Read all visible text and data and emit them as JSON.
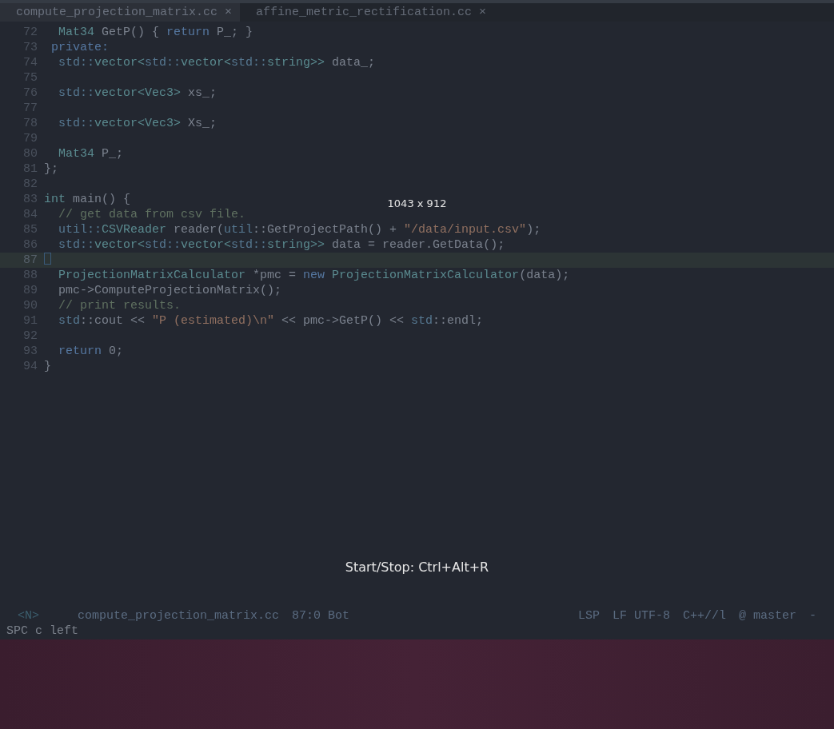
{
  "tabs": [
    {
      "label": "compute_projection_matrix.cc",
      "close": "×",
      "selected": true
    },
    {
      "label": "affine_metric_rectification.cc",
      "close": "×",
      "selected": false
    }
  ],
  "editor": {
    "lines": [
      {
        "number": "72",
        "current": false,
        "tokens": [
          {
            "text": "  Mat34",
            "kind": "type"
          },
          {
            "text": " GetP() { "
          },
          {
            "text": "return",
            "kind": "keyword"
          },
          {
            "text": " P_; }"
          }
        ]
      },
      {
        "number": "73",
        "current": false,
        "tokens": [
          {
            "text": " private:",
            "kind": "keyword"
          }
        ]
      },
      {
        "number": "74",
        "current": false,
        "tokens": [
          {
            "text": "  std::",
            "kind": "ns"
          },
          {
            "text": "vector<",
            "kind": "type"
          },
          {
            "text": "std::",
            "kind": "ns"
          },
          {
            "text": "vector<",
            "kind": "type"
          },
          {
            "text": "std::",
            "kind": "ns"
          },
          {
            "text": "string>>",
            "kind": "type"
          },
          {
            "text": " data_;"
          }
        ]
      },
      {
        "number": "75",
        "current": false
      },
      {
        "number": "76",
        "current": false,
        "tokens": [
          {
            "text": "  std::",
            "kind": "ns"
          },
          {
            "text": "vector<Vec3>",
            "kind": "type"
          },
          {
            "text": " xs_;"
          }
        ]
      },
      {
        "number": "77",
        "current": false
      },
      {
        "number": "78",
        "current": false,
        "tokens": [
          {
            "text": "  std::",
            "kind": "ns"
          },
          {
            "text": "vector<Vec3>",
            "kind": "type"
          },
          {
            "text": " Xs_;"
          }
        ]
      },
      {
        "number": "79",
        "current": false
      },
      {
        "number": "80",
        "current": false,
        "tokens": [
          {
            "text": "  Mat34",
            "kind": "type"
          },
          {
            "text": " P_;"
          }
        ]
      },
      {
        "number": "81",
        "current": false,
        "tokens": [
          {
            "text": "};"
          }
        ]
      },
      {
        "number": "82",
        "current": false
      },
      {
        "number": "83",
        "current": false,
        "tokens": [
          {
            "text": "int",
            "kind": "type"
          },
          {
            "text": " main() {"
          }
        ]
      },
      {
        "number": "84",
        "current": false,
        "tokens": [
          {
            "text": "  // get data from csv file.",
            "kind": "comment"
          }
        ]
      },
      {
        "number": "85",
        "current": false,
        "tokens": [
          {
            "text": "  util::",
            "kind": "ns"
          },
          {
            "text": "CSVReader",
            "kind": "type"
          },
          {
            "text": " reader("
          },
          {
            "text": "util",
            "kind": "ns"
          },
          {
            "text": "::GetProjectPath() + "
          },
          {
            "text": "\"/data/input.csv\"",
            "kind": "string"
          },
          {
            "text": ");"
          }
        ]
      },
      {
        "number": "86",
        "current": false,
        "tokens": [
          {
            "text": "  std::",
            "kind": "ns"
          },
          {
            "text": "vector<",
            "kind": "type"
          },
          {
            "text": "std::",
            "kind": "ns"
          },
          {
            "text": "vector<",
            "kind": "type"
          },
          {
            "text": "std::",
            "kind": "ns"
          },
          {
            "text": "string>>",
            "kind": "type"
          },
          {
            "text": " data = reader.GetData();"
          }
        ]
      },
      {
        "number": "87",
        "current": true
      },
      {
        "number": "88",
        "current": false,
        "tokens": [
          {
            "text": "  ProjectionMatrixCalculator",
            "kind": "type"
          },
          {
            "text": " *pmc = "
          },
          {
            "text": "new",
            "kind": "keyword"
          },
          {
            "text": " ProjectionMatrixCalculator",
            "kind": "type"
          },
          {
            "text": "(data);"
          }
        ]
      },
      {
        "number": "89",
        "current": false,
        "tokens": [
          {
            "text": "  pmc->ComputeProjectionMatrix();"
          }
        ]
      },
      {
        "number": "90",
        "current": false,
        "tokens": [
          {
            "text": "  // print results.",
            "kind": "comment"
          }
        ]
      },
      {
        "number": "91",
        "current": false,
        "tokens": [
          {
            "text": "  std",
            "kind": "ns"
          },
          {
            "text": "::cout << "
          },
          {
            "text": "\"P (estimated)\\n\"",
            "kind": "string"
          },
          {
            "text": " << pmc->GetP() << "
          },
          {
            "text": "std",
            "kind": "ns"
          },
          {
            "text": "::endl;"
          }
        ]
      },
      {
        "number": "92",
        "current": false
      },
      {
        "number": "93",
        "current": false,
        "tokens": [
          {
            "text": "  return",
            "kind": "keyword"
          },
          {
            "text": " 0;"
          }
        ]
      },
      {
        "number": "94",
        "current": false,
        "tokens": [
          {
            "text": "}"
          }
        ]
      }
    ]
  },
  "overlays": [
    "1043 x 912",
    "Start/Stop: Ctrl+Alt+R"
  ],
  "status_bar": {
    "mode": "<N>",
    "file": "compute_projection_matrix.cc",
    "position": "87:0 Bot",
    "right": [
      "LSP",
      "LF UTF-8",
      "C++//l",
      "@ master",
      "-"
    ]
  },
  "minibuffer": "SPC c left"
}
